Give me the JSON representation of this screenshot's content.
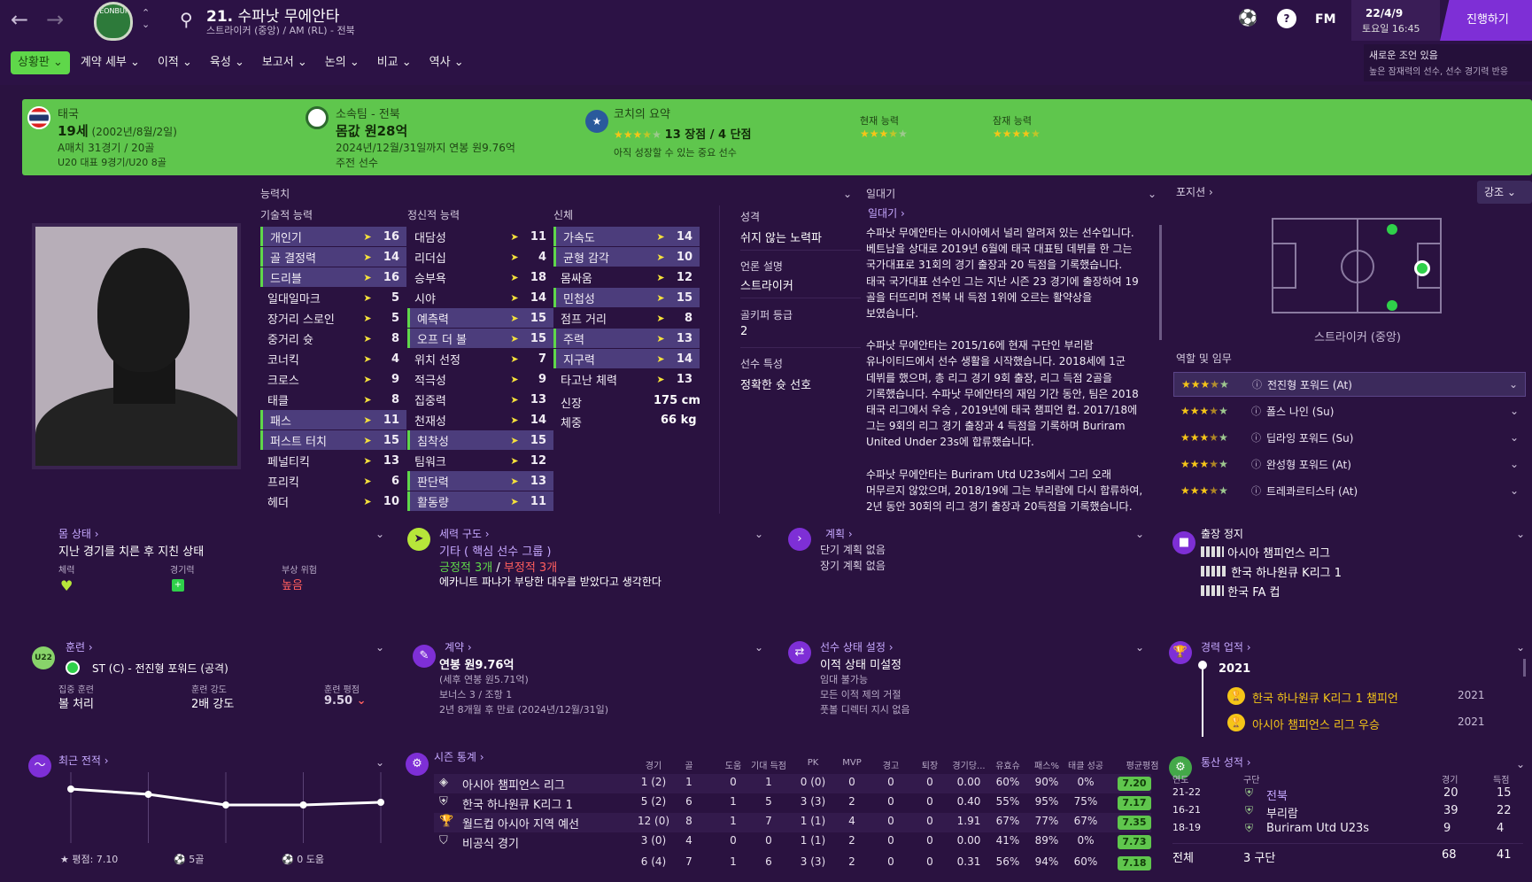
{
  "header": {
    "number": "21.",
    "name": "수파낫 무에안타",
    "sub": "스트라이커 (중앙) / AM (RL) - 전북",
    "club_badge_text": "JEONBUK",
    "fm": "FM",
    "date": "22/4/9",
    "datetime": "토요일 16:45",
    "continue_btn": "진행하기",
    "notice1": "새로운 조언 있음",
    "notice2": "높은 잠재력의 선수, 선수 경기력 반응"
  },
  "tabs": [
    "상황판",
    "계약 세부",
    "이적",
    "육성",
    "보고서",
    "논의",
    "비교",
    "역사"
  ],
  "banner": {
    "nation": "태국",
    "age_label": "19세",
    "birth": "(2002년/8월/2일)",
    "caps": "A매치 31경기 / 20골",
    "u20": "U20 대표 9경기/U20 8골",
    "club_label": "소속팀 - 전북",
    "value": "몸값 원28억",
    "contract": "2024년/12월/31일까지 연봉 원9.76억",
    "role": "주전 선수",
    "coach_label": "코치의 요약",
    "coach_stats": "13 장점 / 4 단점",
    "coach_note": "아직 성장할 수 있는 중요 선수",
    "cur_ability": "현재 능력",
    "pot_ability": "잠재 능력",
    "coach_stars": 3.5,
    "cur_stars": 3.5,
    "pot_stars": 4.5
  },
  "attributes": {
    "title": "능력치",
    "tech_title": "기술적 능력",
    "mental_title": "정신적 능력",
    "phys_title": "신체",
    "technical": [
      {
        "n": "개인기",
        "v": "16",
        "hl": true
      },
      {
        "n": "골 결정력",
        "v": "14",
        "hl": true
      },
      {
        "n": "드리블",
        "v": "16",
        "hl": true
      },
      {
        "n": "일대일마크",
        "v": "5"
      },
      {
        "n": "장거리 스로인",
        "v": "5"
      },
      {
        "n": "중거리 슛",
        "v": "8"
      },
      {
        "n": "코너킥",
        "v": "4"
      },
      {
        "n": "크로스",
        "v": "9"
      },
      {
        "n": "태클",
        "v": "8"
      },
      {
        "n": "패스",
        "v": "11",
        "hl": true
      },
      {
        "n": "퍼스트 터치",
        "v": "15",
        "hl": true
      },
      {
        "n": "페널티킥",
        "v": "13"
      },
      {
        "n": "프리킥",
        "v": "6"
      },
      {
        "n": "헤더",
        "v": "10"
      }
    ],
    "mental": [
      {
        "n": "대담성",
        "v": "11"
      },
      {
        "n": "리더십",
        "v": "4"
      },
      {
        "n": "승부욕",
        "v": "18"
      },
      {
        "n": "시야",
        "v": "14"
      },
      {
        "n": "예측력",
        "v": "15",
        "hl": true
      },
      {
        "n": "오프 더 볼",
        "v": "15",
        "hl": true
      },
      {
        "n": "위치 선정",
        "v": "7"
      },
      {
        "n": "적극성",
        "v": "9"
      },
      {
        "n": "집중력",
        "v": "13"
      },
      {
        "n": "천재성",
        "v": "14"
      },
      {
        "n": "침착성",
        "v": "15",
        "hl": true
      },
      {
        "n": "팀워크",
        "v": "12"
      },
      {
        "n": "판단력",
        "v": "13",
        "hl": true
      },
      {
        "n": "활동량",
        "v": "11",
        "hl": true
      }
    ],
    "physical": [
      {
        "n": "가속도",
        "v": "14",
        "hl": true
      },
      {
        "n": "균형 감각",
        "v": "10",
        "hl": true
      },
      {
        "n": "몸싸움",
        "v": "12"
      },
      {
        "n": "민첩성",
        "v": "15",
        "hl": true
      },
      {
        "n": "점프 거리",
        "v": "8"
      },
      {
        "n": "주력",
        "v": "13",
        "hl": true
      },
      {
        "n": "지구력",
        "v": "14",
        "hl": true
      },
      {
        "n": "타고난 체력",
        "v": "13"
      }
    ],
    "height_label": "신장",
    "height": "175 cm",
    "weight_label": "체중",
    "weight": "66 kg"
  },
  "personality": {
    "p_label": "성격",
    "p_val": "쉬지 않는 노력파",
    "m_label": "언론 설명",
    "m_val": "스트라이커",
    "g_label": "골키퍼 등급",
    "g_val": "2",
    "t_label": "선수 특성",
    "t_val": "정확한 슛 선호"
  },
  "bio": {
    "title": "일대기",
    "link": "일대기",
    "lines": [
      "수파낫 무에안타는 아시아에서 널리 알려져 있는 선수입니다.",
      "베트남을 상대로 2019년 6월에 태국 대표팀 데뷔를 한 그는",
      "국가대표로 31회의 경기 출장과 20 득점을 기록했습니다.",
      "태국 국가대표 선수인 그는 지난 시즌 23 경기에 출장하여 19",
      "골을 터뜨리며 전북 내 득점 1위에 오르는 활약상을",
      "보였습니다.",
      "",
      "수파낫 무에안타는 2015/16에 현재 구단인 부리람",
      "유나이티드에서 선수 생활을 시작했습니다. 2018세에 1군",
      "데뷔를 했으며, 총 리그 경기 9회 출장, 리그 득점 2골을",
      "기록했습니다. 수파낫 무에안타의 재임 기간 동안, 팀은 2018",
      "태국 리그에서 우승 , 2019년에 태국 챔피언 컵. 2017/18에",
      "그는 9회의 리그 경기 출장과 4 득점을 기록하며 Buriram",
      "United Under 23s에 합류했습니다.",
      "",
      "수파낫 무에안타는 Buriram Utd U23s에서 그리 오래",
      "머무르지 않았으며, 2018/19에 그는 부리람에 다시 합류하여,",
      "2년 동안 30회의 리그 경기 출장과 20득점을 기록했습니다."
    ]
  },
  "position": {
    "title": "포지션",
    "dropdown": "강조",
    "label": "스트라이커 (중앙)",
    "roles_title": "역할 및 임무",
    "roles": [
      {
        "name": "전진형 포워드 (At)",
        "stars": 3.5,
        "sel": true
      },
      {
        "name": "폴스 나인 (Su)",
        "stars": 3.5
      },
      {
        "name": "딥라잉 포워드 (Su)",
        "stars": 3.5
      },
      {
        "name": "완성형 포워드 (At)",
        "stars": 3.5
      },
      {
        "name": "트레콰르티스타 (At)",
        "stars": 3.5
      }
    ]
  },
  "condition": {
    "title": "몸 상태",
    "text": "지난 경기를 치른 후 지친 상태",
    "f_label": "체력",
    "s_label": "경기력",
    "i_label": "부상 위험",
    "i_val": "높음"
  },
  "dynamics": {
    "title": "세력 구도",
    "group": "기타 ( 핵심 선수 그룹 )",
    "pos": "긍정적 3개",
    "slash": " / ",
    "neg": "부정적 3개",
    "note": "에카니트 파냐가 부당한 대우를 받았다고 생각한다"
  },
  "plans": {
    "title": "계획",
    "short": "단기 계획 없음",
    "long": "장기 계획 없음"
  },
  "suspension": {
    "title": "출장 정지",
    "items": [
      "아시아 챔피언스 리그",
      "한국 하나원큐 K리그 1",
      "한국 FA 컵"
    ]
  },
  "training": {
    "title": "훈련",
    "badge": "U22",
    "role": "ST (C) - 전진형 포워드 (공격)",
    "f_label": "집중 훈련",
    "f_val": "볼 처리",
    "i_label": "훈련 강도",
    "i_val": "2배 강도",
    "r_label": "훈련 평점",
    "r_val": "9.50"
  },
  "contract": {
    "title": "계약",
    "wage": "연봉 원9.76억",
    "sub1": "(세후 연봉 원5.71억)",
    "sub2": "보너스 3 / 조항 1",
    "sub3": "2년 8개월 후 만료 (2024년/12월/31일)"
  },
  "status": {
    "title": "선수 상태 설정",
    "l1": "이적 상태 미설정",
    "l2": "임대 불가능",
    "l3": "모든 이적 제의 거절",
    "l4": "풋볼 디렉터 지시 없음"
  },
  "honours": {
    "title": "경력 업적",
    "year": "2021",
    "items": [
      {
        "n": "한국 하나원큐 K리그 1 챔피언",
        "y": "2021"
      },
      {
        "n": "아시아 챔피언스 리그 우승",
        "y": "2021"
      }
    ]
  },
  "form": {
    "title": "최근 전적",
    "rating": "평점: 7.10",
    "goals": "5골",
    "assists": "0 도움",
    "chart_data": {
      "type": "line",
      "values": [
        7.25,
        7.15,
        6.95,
        6.95,
        7.0
      ]
    }
  },
  "season": {
    "title": "시즌 통계",
    "headers": [
      "경기",
      "골",
      "도움",
      "기대 득점",
      "PK",
      "MVP",
      "경고",
      "퇴장",
      "경기당...",
      "유효슈",
      "패스%",
      "태클 성공",
      "평균평점"
    ],
    "rows": [
      {
        "comp": "아시아 챔피언스 리그",
        "v": [
          "1 (2)",
          "1",
          "0",
          "1",
          "0 (0)",
          "0",
          "0",
          "0",
          "0.00",
          "60%",
          "90%",
          "0%"
        ],
        "r": "7.20"
      },
      {
        "comp": "한국 하나원큐 K리그 1",
        "v": [
          "5 (2)",
          "6",
          "1",
          "5",
          "3 (3)",
          "2",
          "0",
          "0",
          "0.40",
          "55%",
          "95%",
          "75%"
        ],
        "r": "7.17"
      },
      {
        "comp": "월드컵 아시아 지역 예선",
        "v": [
          "12 (0)",
          "8",
          "1",
          "7",
          "1 (1)",
          "4",
          "0",
          "0",
          "1.91",
          "67%",
          "77%",
          "67%"
        ],
        "r": "7.35"
      },
      {
        "comp": "비공식 경기",
        "v": [
          "3 (0)",
          "4",
          "0",
          "0",
          "1 (1)",
          "2",
          "0",
          "0",
          "0.00",
          "41%",
          "89%",
          "0%"
        ],
        "r": "7.73"
      }
    ],
    "total": [
      "6 (4)",
      "7",
      "1",
      "6",
      "3 (3)",
      "2",
      "0",
      "0",
      "0.31",
      "56%",
      "94%",
      "60%"
    ],
    "total_r": "7.18"
  },
  "career": {
    "title": "통산 성적",
    "h_year": "연도",
    "h_club": "구단",
    "h_apps": "경기",
    "h_goals": "득점",
    "rows": [
      {
        "y": "21-22",
        "c": "전북",
        "a": "20",
        "g": "15"
      },
      {
        "y": "16-21",
        "c": "부리람",
        "a": "39",
        "g": "22"
      },
      {
        "y": "18-19",
        "c": "Buriram Utd U23s",
        "a": "9",
        "g": "4"
      }
    ],
    "total_label": "전체",
    "total_clubs": "3 구단",
    "total_apps": "68",
    "total_goals": "41"
  }
}
